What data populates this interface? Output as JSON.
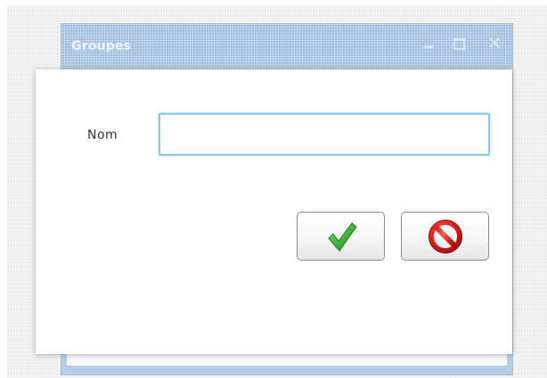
{
  "background_window": {
    "title": "Groupes",
    "controls": [
      "minimize-icon",
      "maximize-icon",
      "close-icon"
    ]
  },
  "dialog": {
    "name_label": "Nom",
    "name_value": "",
    "ok_button_icon": "checkmark-icon",
    "cancel_button_icon": "no-entry-icon"
  },
  "colors": {
    "titlebar": "#a5c1e0",
    "input_border": "#8cc7ea",
    "check_green": "#3db33a",
    "cancel_red": "#e02020"
  }
}
